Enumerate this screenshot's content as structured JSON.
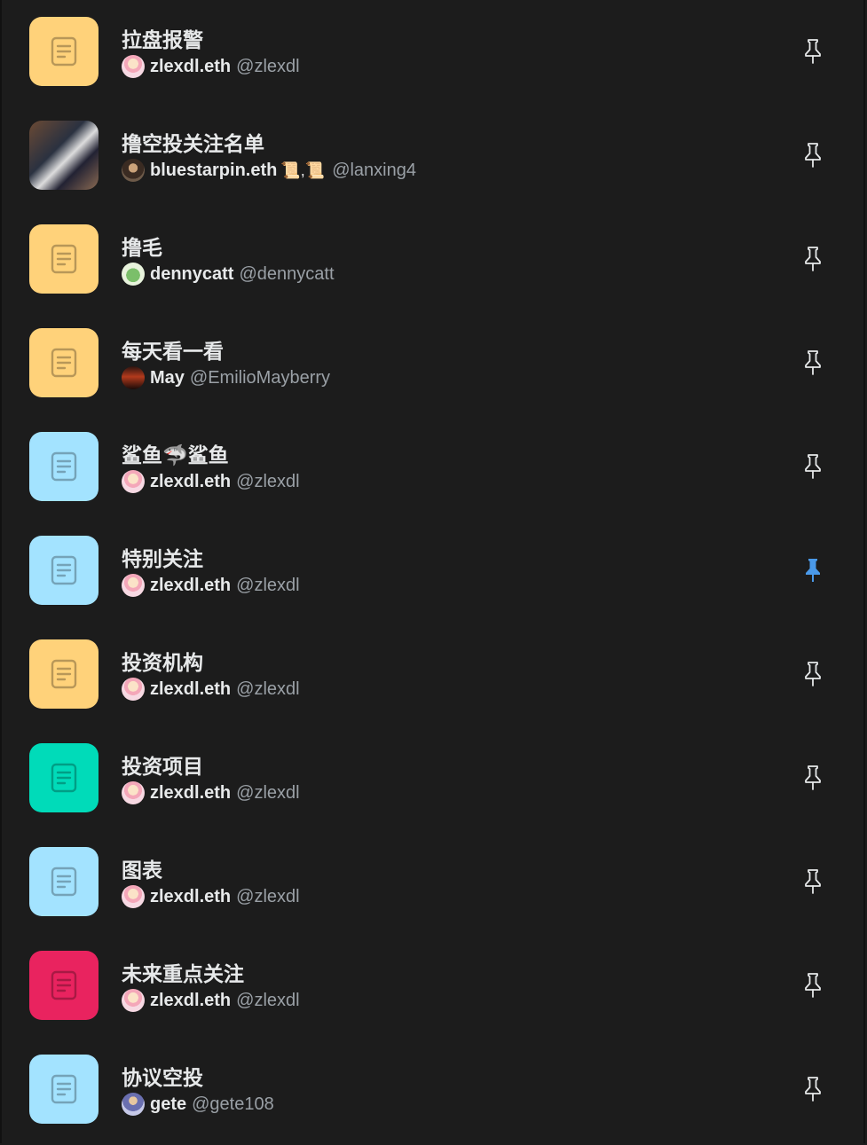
{
  "lists": [
    {
      "title": "拉盘报警",
      "owner": "zlexdl.eth",
      "handle": "@zlexdl",
      "color": "#ffd27a",
      "icon": "list-icon",
      "avatar": "zlexdl",
      "pinned": false
    },
    {
      "title": "撸空投关注名单",
      "owner": "bluestarpin.eth",
      "owner_suffix": "📜,📜",
      "handle": "@lanxing4",
      "color": "photo",
      "icon": "photo",
      "avatar": "bluestar",
      "pinned": false
    },
    {
      "title": "撸毛",
      "owner": "dennycatt",
      "handle": "@dennycatt",
      "color": "#ffd27a",
      "icon": "list-icon",
      "avatar": "denny",
      "pinned": false
    },
    {
      "title": "每天看一看",
      "owner": "May",
      "handle": "@EmilioMayberry",
      "color": "#ffd27a",
      "icon": "list-icon",
      "avatar": "may",
      "pinned": false
    },
    {
      "title": "鲨鱼🦈鲨鱼",
      "owner": "zlexdl.eth",
      "handle": "@zlexdl",
      "color": "#a3e3ff",
      "icon": "list-icon",
      "avatar": "zlexdl",
      "pinned": false
    },
    {
      "title": "特别关注",
      "owner": "zlexdl.eth",
      "handle": "@zlexdl",
      "color": "#a3e3ff",
      "icon": "list-icon",
      "avatar": "zlexdl",
      "pinned": true
    },
    {
      "title": "投资机构",
      "owner": "zlexdl.eth",
      "handle": "@zlexdl",
      "color": "#ffd27a",
      "icon": "list-icon",
      "avatar": "zlexdl",
      "pinned": false
    },
    {
      "title": "投资项目",
      "owner": "zlexdl.eth",
      "handle": "@zlexdl",
      "color": "#00dbb9",
      "icon": "list-icon",
      "avatar": "zlexdl",
      "pinned": false
    },
    {
      "title": "图表",
      "owner": "zlexdl.eth",
      "handle": "@zlexdl",
      "color": "#a3e3ff",
      "icon": "list-icon",
      "avatar": "zlexdl",
      "pinned": false
    },
    {
      "title": "未来重点关注",
      "owner": "zlexdl.eth",
      "handle": "@zlexdl",
      "color": "#e9235f",
      "icon": "list-icon",
      "avatar": "zlexdl",
      "pinned": false
    },
    {
      "title": "协议空投",
      "owner": "gete",
      "handle": "@gete108",
      "color": "#a3e3ff",
      "icon": "list-icon",
      "avatar": "gete",
      "pinned": false
    }
  ],
  "colors": {
    "pin_active": "#4a99e9",
    "pin_inactive": "#e7e9ea",
    "background": "#1c1c1c"
  }
}
